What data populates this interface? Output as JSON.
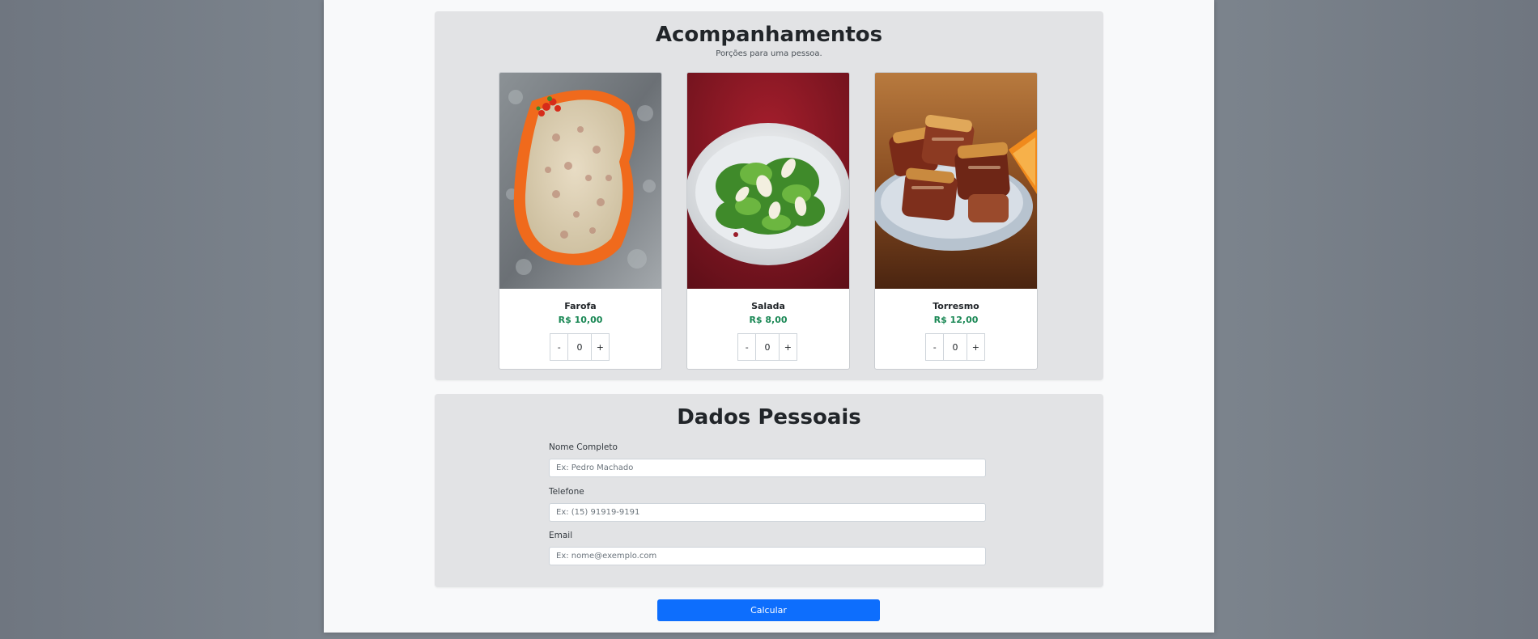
{
  "sides_section": {
    "title": "Acompanhamentos",
    "subtitle": "Porções para uma pessoa."
  },
  "products": [
    {
      "name": "Farofa",
      "price": "R$ 10,00",
      "qty": "0",
      "image": "farofa-photo",
      "decrement": "-",
      "increment": "+"
    },
    {
      "name": "Salada",
      "price": "R$ 8,00",
      "qty": "0",
      "image": "salad-photo",
      "decrement": "-",
      "increment": "+"
    },
    {
      "name": "Torresmo",
      "price": "R$ 12,00",
      "qty": "0",
      "image": "pork-crackling-photo",
      "decrement": "-",
      "increment": "+"
    }
  ],
  "personal_section": {
    "title": "Dados Pessoais",
    "fields": [
      {
        "label": "Nome Completo",
        "placeholder": "Ex: Pedro Machado",
        "value": ""
      },
      {
        "label": "Telefone",
        "placeholder": "Ex: (15) 91919-9191",
        "value": ""
      },
      {
        "label": "Email",
        "placeholder": "Ex: nome@exemplo.com",
        "value": ""
      }
    ]
  },
  "calculate_button": "Calcular",
  "colors": {
    "accent": "#0d6efd",
    "price": "#198754",
    "section_bg": "#e2e3e5",
    "page_bg": "#f8f9fa"
  }
}
